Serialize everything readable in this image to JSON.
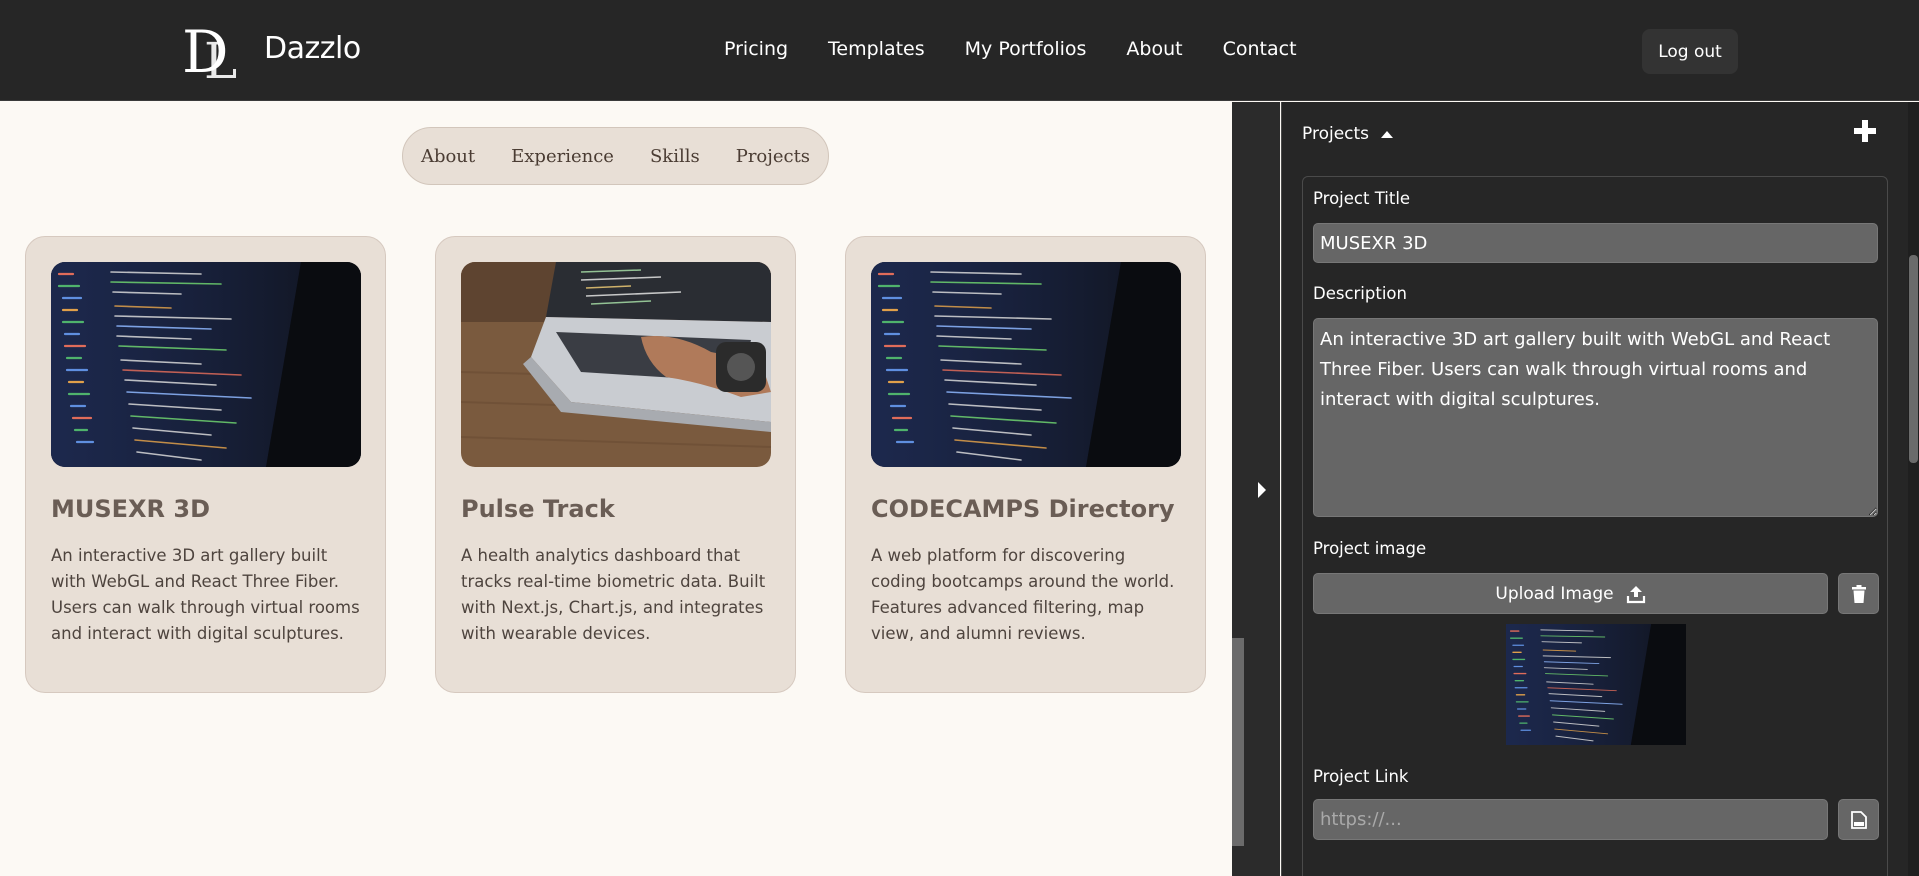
{
  "brand": {
    "name": "Dazzlo"
  },
  "nav": {
    "items": [
      "Pricing",
      "Templates",
      "My Portfolios",
      "About",
      "Contact"
    ],
    "logout_label": "Log out"
  },
  "section_nav": [
    "About",
    "Experience",
    "Skills",
    "Projects"
  ],
  "projects": [
    {
      "title": "MUSEXR 3D",
      "description": "An interactive 3D art gallery built with WebGL and React Three Fiber. Users can walk through virtual rooms and interact with digital sculptures."
    },
    {
      "title": "Pulse Track",
      "description": "A health analytics dashboard that tracks real-time biometric data. Built with Next.js, Chart.js, and integrates with wearable devices."
    },
    {
      "title": "CODECAMPS Directory",
      "description": "A web platform for discovering coding bootcamps around the world. Features advanced filtering, map view, and alumni reviews."
    }
  ],
  "editor": {
    "section_title": "Projects",
    "labels": {
      "title": "Project Title",
      "description": "Description",
      "image": "Project image",
      "link": "Project Link"
    },
    "title_value": "MUSEXR 3D",
    "description_value": "An interactive 3D art gallery built with WebGL and React Three Fiber. Users can walk through virtual rooms and interact with digital sculptures.",
    "upload_label": "Upload Image",
    "link_placeholder": "https://..."
  },
  "colors": {
    "header_bg": "#262626",
    "preview_bg": "#fcf9f4",
    "card_bg": "#e8dfd6",
    "field_bg": "#666666"
  }
}
